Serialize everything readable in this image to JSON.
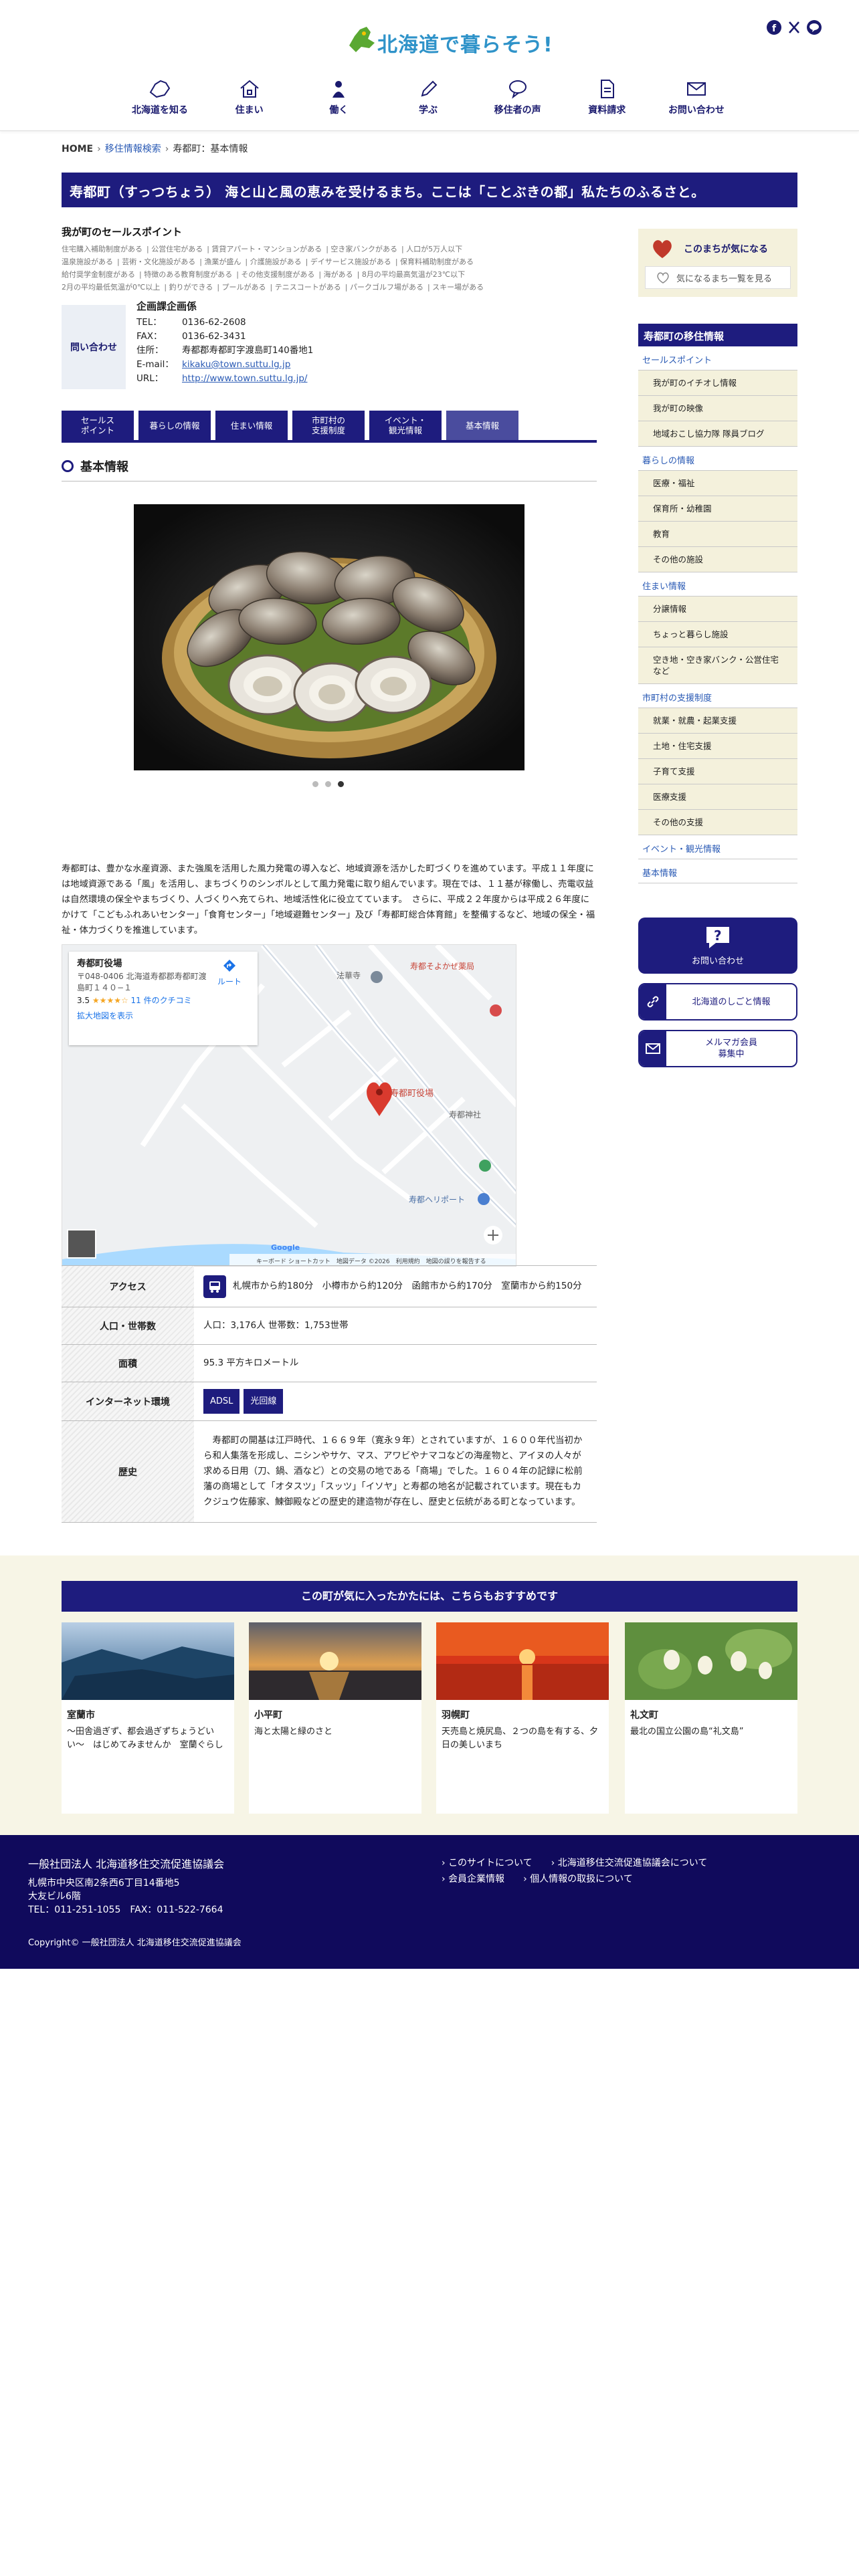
{
  "header": {
    "logo_text": "北海道で暮らそう!",
    "nav": [
      {
        "label": "北海道を知る",
        "icon": "hokkaido-map-icon"
      },
      {
        "label": "住まい",
        "icon": "house-icon"
      },
      {
        "label": "働く",
        "icon": "worker-icon"
      },
      {
        "label": "学ぶ",
        "icon": "pencil-icon"
      },
      {
        "label": "移住者の声",
        "icon": "speech-bubble-icon"
      },
      {
        "label": "資料請求",
        "icon": "document-icon"
      },
      {
        "label": "お問い合わせ",
        "icon": "mail-icon"
      }
    ],
    "social": [
      "facebook-icon",
      "x-icon",
      "line-icon"
    ]
  },
  "breadcrumb": {
    "home": "HOME",
    "search": "移住情報検索",
    "current": "寿都町：基本情報"
  },
  "title": "寿都町（すっつちょう） 海と山と風の恵みを受けるまち。ここは「ことぶきの都」私たちのふるさと。",
  "selling_points": {
    "title": "我が町のセールスポイント",
    "tags": [
      "住宅購入補助制度がある",
      "公営住宅がある",
      "賃貸アパート・マンションがある",
      "空き家バンクがある",
      "人口が5万人以下",
      "温泉施設がある",
      "芸術・文化施設がある",
      "漁業が盛ん",
      "介護施設がある",
      "デイサービス施設がある",
      "保育料補助制度がある",
      "給付奨学金制度がある",
      "特徴のある教育制度がある",
      "その他支援制度がある",
      "海がある",
      "8月の平均最高気温が23℃以下",
      "2月の平均最低気温が0℃以上",
      "釣りができる",
      "プールがある",
      "テニスコートがある",
      "パークゴルフ場がある",
      "スキー場がある"
    ]
  },
  "contact": {
    "box_label": "問い合わせ",
    "dept": "企画課企画係",
    "rows": [
      {
        "k": "TEL：",
        "v": "0136-62-2608"
      },
      {
        "k": "FAX：",
        "v": "0136-62-3431"
      },
      {
        "k": "住所：",
        "v": "寿都郡寿都町字渡島町140番地1"
      },
      {
        "k": "E-mail：",
        "v": "kikaku@town.suttu.lg.jp"
      },
      {
        "k": "URL：",
        "v": "http://www.town.suttu.lg.jp/"
      }
    ]
  },
  "tabs": [
    "セールス\nポイント",
    "暮らしの情報",
    "住まい情報",
    "市町村の\n支援制度",
    "イベント・\n観光情報",
    "基本情報"
  ],
  "section_title": "基本情報",
  "intro": "寿都町は、豊かな水産資源、また強風を活用した風力発電の導入など、地域資源を活かした町づくりを進めています。平成１１年度には地域資源である「風」を活用し、まちづくりのシンボルとして風力発電に取り組んでいます。現在では、１１基が稼働し、売電収益は自然環境の保全やまちづくり、人づくりへ充てられ、地域活性化に役立てています。　さらに、平成２２年度からは平成２６年度にかけて「こどもふれあいセンター」「食育センター」「地域避難センター」及び「寿都町総合体育館」を整備するなど、地域の保全・福祉・体力づくりを推進しています。",
  "map": {
    "place": "寿都町役場",
    "address": "〒048-0406 北海道寿都郡寿都町渡島町１４０−１",
    "rating": "3.5",
    "stars": "★★★★☆",
    "reviews": "11 件のクチコミ",
    "route": "ルート",
    "enlarge": "拡大地図を表示",
    "labels": [
      "法華寺",
      "寿都そよかぜ薬局",
      "寿都町役場",
      "寿都神社",
      "寿都ヘリポート"
    ],
    "footer": "キーボード ショートカット　地図データ ©2026　利用規約　地図の誤りを報告する",
    "google": "Google"
  },
  "info": {
    "access_label": "アクセス",
    "access": "札幌市から約180分　小樽市から約120分　函館市から約170分　室蘭市から約150分",
    "population_label": "人口・世帯数",
    "population": "人口：3,176人 世帯数：1,753世帯",
    "area_label": "面積",
    "area": "95.3 平方キロメートル",
    "internet_label": "インターネット環境",
    "internet": [
      "ADSL",
      "光回線"
    ],
    "history_label": "歴史",
    "history": "　寿都町の開基は江戸時代、１６６９年（寛永９年）とされていますが、１６００年代当初から和人集落を形成し、ニシンやサケ、マス、アワビやナマコなどの海産物と、アイヌの人々が求める日用（刀、鍋、酒など）との交易の地である「商場」でした。１６０４年の記録に松前藩の商場として「オタスツ」「スッツ」「イソヤ」と寿都の地名が記載されています。現在もカクジュウ佐藤家、鰊御殿などの歴史的建造物が存在し、歴史と伝統がある町となっています。"
  },
  "sidebar": {
    "fav_title": "このまちが気になる",
    "fav_button": "気になるまち一覧を見る",
    "title": "寿都町の移住情報",
    "sections": [
      {
        "cat": "セールスポイント",
        "items": [
          "我が町のイチオし情報",
          "我が町の映像",
          "地域おこし協力隊 隊員ブログ"
        ]
      },
      {
        "cat": "暮らしの情報",
        "items": [
          "医療・福祉",
          "保育所・幼稚園",
          "教育",
          "その他の施設"
        ]
      },
      {
        "cat": "住まい情報",
        "items": [
          "分譲情報",
          "ちょっと暮らし施設",
          "空き地・空き家バンク・公営住宅など"
        ]
      },
      {
        "cat": "市町村の支援制度",
        "items": [
          "就業・就農・起業支援",
          "土地・住宅支援",
          "子育て支援",
          "医療支援",
          "その他の支援"
        ]
      },
      {
        "cat": "イベント・観光情報",
        "items": []
      },
      {
        "cat": "基本情報",
        "items": []
      }
    ],
    "buttons": [
      {
        "label": "お問い合わせ",
        "icon": "question-bubble-icon"
      },
      {
        "label": "北海道のしごと情報",
        "icon": "link-icon"
      },
      {
        "label": "メルマガ会員\n募集中",
        "icon": "mail-icon"
      }
    ]
  },
  "recommend": {
    "title": "この町が気に入ったかたには、こちらもおすすめです",
    "cards": [
      {
        "name": "室蘭市",
        "desc": "〜田舎過ぎず、都会過ぎずちょうどいい〜　はじめてみませんか　室蘭ぐらし"
      },
      {
        "name": "小平町",
        "desc": "海と太陽と緑のさと"
      },
      {
        "name": "羽幌町",
        "desc": "天売島と焼尻島、２つの島を有する、夕日の美しいまち"
      },
      {
        "name": "礼文町",
        "desc": "最北の国立公園の島“礼文島”"
      }
    ]
  },
  "footer": {
    "org": "一般社団法人 北海道移住交流促進協議会",
    "address1": "札幌市中央区南2条西6丁目14番地5",
    "address2": "大友ビル6階",
    "tel": "TEL：011-251-1055　FAX：011-522-7664",
    "copyright": "Copyright© 一般社団法人 北海道移住交流促進協議会",
    "links": [
      "このサイトについて",
      "北海道移住交流促進協議会について",
      "会員企業情報",
      "個人情報の取扱について"
    ]
  }
}
